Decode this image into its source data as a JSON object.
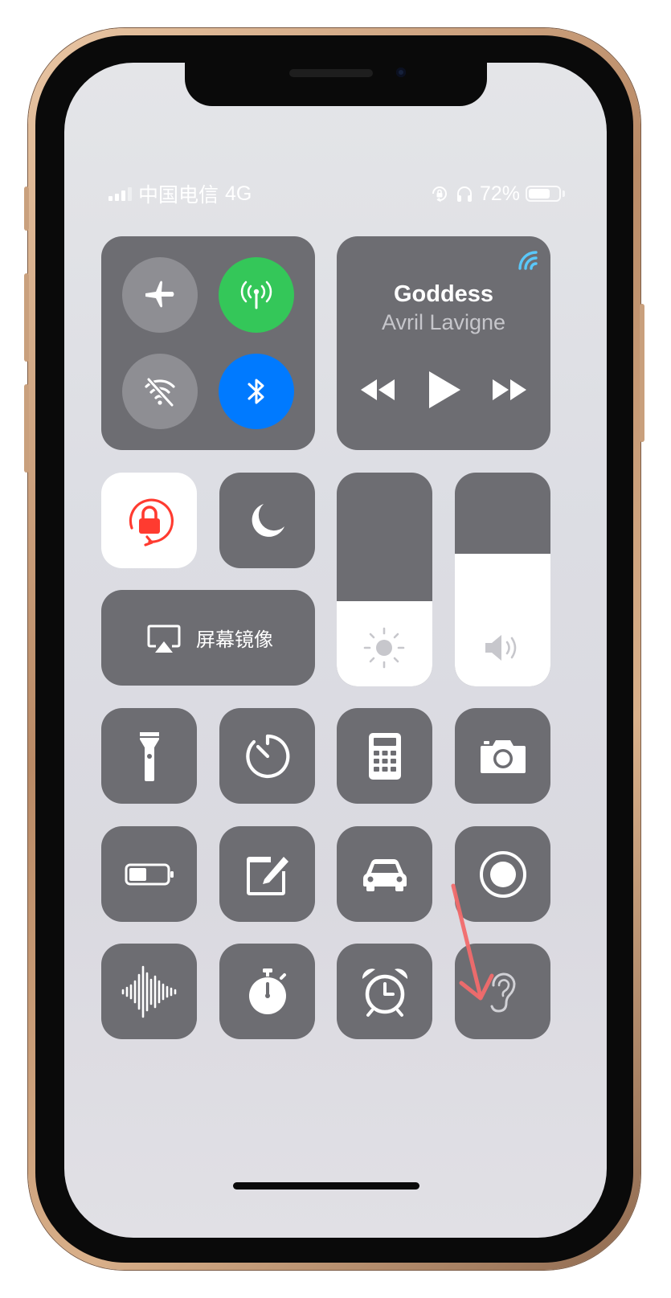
{
  "status_bar": {
    "carrier": "中国电信",
    "network": "4G",
    "battery_percent_label": "72%",
    "battery_level": 0.72
  },
  "connectivity": {
    "airplane": {
      "icon": "airplane-icon",
      "on": false
    },
    "cellular": {
      "icon": "antenna-icon",
      "on": true,
      "color": "#34c759"
    },
    "wifi": {
      "icon": "wifi-off-icon",
      "on": false
    },
    "bluetooth": {
      "icon": "bluetooth-icon",
      "on": true,
      "color": "#007aff"
    }
  },
  "now_playing": {
    "title": "Goddess",
    "artist": "Avril Lavigne",
    "airplay_color": "#5ac8fa"
  },
  "toggles": {
    "orientation_lock": {
      "icon": "orientation-lock-icon",
      "on": true,
      "color": "#ff3b30"
    },
    "do_not_disturb": {
      "icon": "moon-icon",
      "on": false
    }
  },
  "screen_mirroring": {
    "label": "屏幕镜像",
    "icon": "airplay-icon"
  },
  "sliders": {
    "brightness": {
      "icon": "sun-icon",
      "level": 0.4
    },
    "volume": {
      "icon": "speaker-icon",
      "level": 0.62
    }
  },
  "controls": [
    {
      "icon": "flashlight-icon"
    },
    {
      "icon": "timer-icon"
    },
    {
      "icon": "calculator-icon"
    },
    {
      "icon": "camera-icon"
    },
    {
      "icon": "low-power-battery-icon"
    },
    {
      "icon": "notes-icon"
    },
    {
      "icon": "car-icon"
    },
    {
      "icon": "screen-record-icon"
    },
    {
      "icon": "voice-memo-icon"
    },
    {
      "icon": "stopwatch-icon"
    },
    {
      "icon": "alarm-icon"
    },
    {
      "icon": "hearing-icon"
    }
  ],
  "colors": {
    "tile": "#6d6d72",
    "annotation_arrow": "#f26b6b"
  }
}
